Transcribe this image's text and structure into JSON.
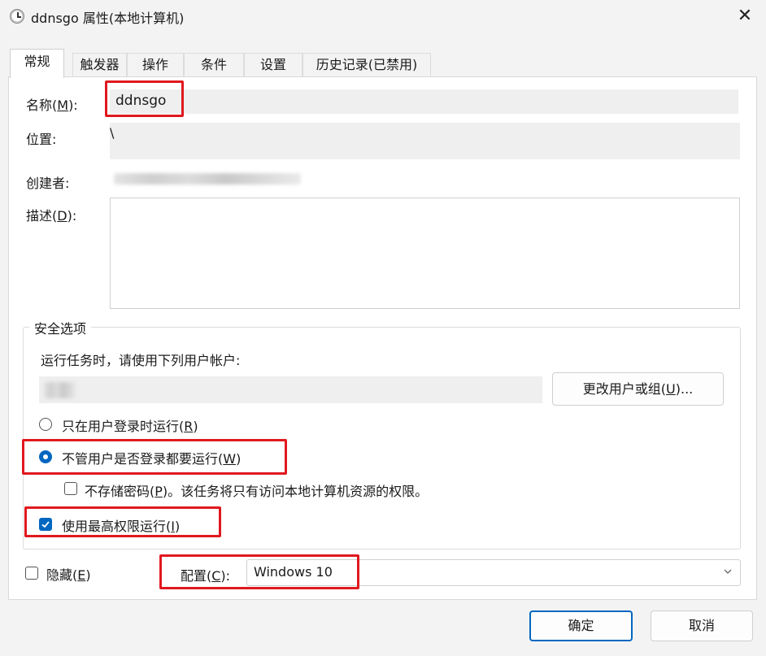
{
  "window": {
    "title": "ddnsgo 属性(本地计算机)"
  },
  "tabs": [
    "常规",
    "触发器",
    "操作",
    "条件",
    "设置",
    "历史记录(已禁用)"
  ],
  "general": {
    "name_label_pre": "名称(",
    "name_label_key": "M",
    "name_label_post": "):",
    "name_value": "ddnsgo",
    "location_label": "位置:",
    "location_value": "\\",
    "author_label": "创建者:",
    "desc_label_pre": "描述(",
    "desc_label_key": "D",
    "desc_label_post": "):"
  },
  "security": {
    "title": "安全选项",
    "run_as_text": "运行任务时，请使用下列用户帐户:",
    "change_user_pre": "更改用户或组(",
    "change_user_key": "U",
    "change_user_post": ")...",
    "radio1_pre": "只在用户登录时运行(",
    "radio1_key": "R",
    "radio1_post": ")",
    "radio2_pre": "不管用户是否登录都要运行(",
    "radio2_key": "W",
    "radio2_post": ")",
    "nopwd_pre": "不存储密码(",
    "nopwd_key": "P",
    "nopwd_post": ")。该任务将只有访问本地计算机资源的权限。",
    "highest_pre": "使用最高权限运行(",
    "highest_key": "I",
    "highest_post": ")"
  },
  "bottom": {
    "hidden_pre": "隐藏(",
    "hidden_key": "E",
    "hidden_post": ")",
    "config_pre": "配置(",
    "config_key": "C",
    "config_post": "):",
    "config_value": "Windows 10"
  },
  "buttons": {
    "ok": "确定",
    "cancel": "取消"
  },
  "colors": {
    "accent": "#0067c0",
    "highlight_box": "#e0191f"
  }
}
